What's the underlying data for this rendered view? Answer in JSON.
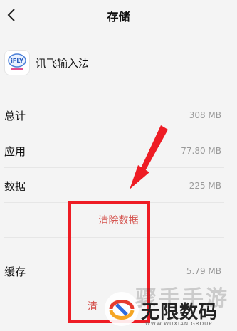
{
  "header": {
    "title": "存储"
  },
  "app": {
    "name": "讯飞输入法",
    "icon_text": "iFLY"
  },
  "rows": {
    "total": {
      "label": "总计",
      "value": "308 MB"
    },
    "app": {
      "label": "应用",
      "value": "77.80 MB"
    },
    "data": {
      "label": "数据",
      "value": "225 MB"
    },
    "cache": {
      "label": "缓存",
      "value": "5.79 MB"
    }
  },
  "actions": {
    "clear_data": "清除数据",
    "clear_cache_partial": "清"
  },
  "watermark": {
    "main": "无限数码",
    "sub": "WWW.WUXIAN GROUP"
  },
  "colors": {
    "accent": "#d5534e",
    "annotation": "#ee1c24"
  }
}
